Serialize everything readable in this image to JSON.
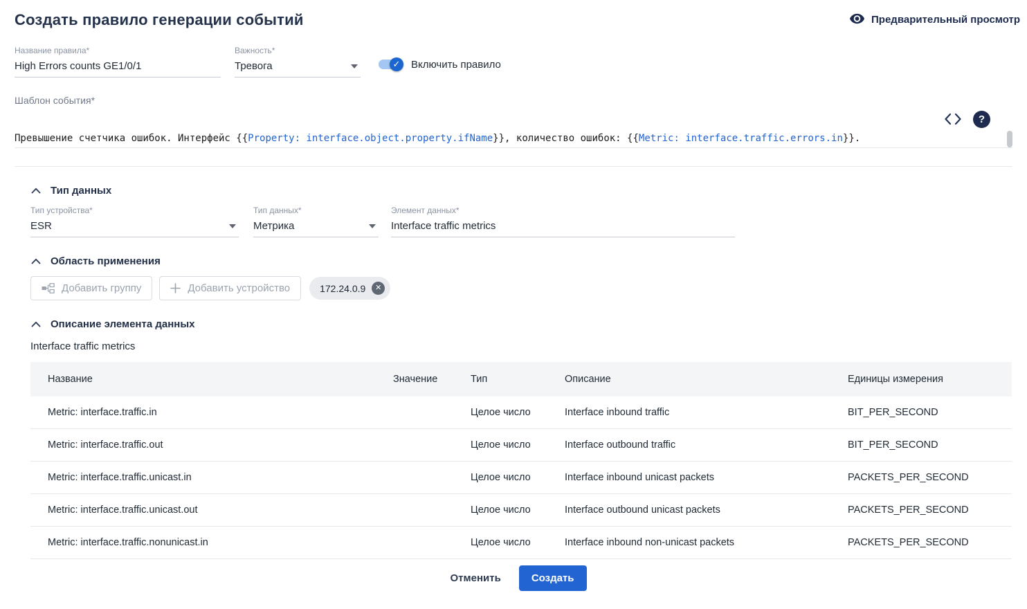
{
  "colors": {
    "accent_blue": "#2264d1",
    "title_navy": "#24324b",
    "token_blue": "#2264d1",
    "table_header_bg": "#f4f5f7"
  },
  "header": {
    "title": "Создать правило генерации событий",
    "preview_label": "Предварительный просмотр"
  },
  "form": {
    "rule_name": {
      "label": "Название правила*",
      "value": "High Errors counts GE1/0/1"
    },
    "severity": {
      "label": "Важность*",
      "value": "Тревога"
    },
    "enable_label": "Включить правило",
    "template_label": "Шаблон события*",
    "template": {
      "p1": "Превышение счетчика ошибок. Интерфейс {{",
      "t1": "Property: interface.object.property.ifName",
      "p2": "}}, количество ошибок: {{",
      "t2": "Metric: interface.traffic.errors.in",
      "p3": "}}."
    }
  },
  "data_type_section": {
    "title": "Тип данных",
    "device_type": {
      "label": "Тип устройства*",
      "value": "ESR"
    },
    "data_kind": {
      "label": "Тип данных*",
      "value": "Метрика"
    },
    "data_element": {
      "label": "Элемент данных*",
      "value": "Interface traffic metrics"
    }
  },
  "scope_section": {
    "title": "Область применения",
    "add_group_label": "Добавить группу",
    "add_device_label": "Добавить устройство",
    "device_chip": "172.24.0.9"
  },
  "description_section": {
    "title": "Описание элемента данных",
    "subtitle": "Interface traffic metrics",
    "headers": [
      "Название",
      "Значение",
      "Тип",
      "Описание",
      "Единицы измерения"
    ],
    "rows": [
      [
        "Metric: interface.traffic.in",
        "",
        "Целое число",
        "Interface inbound traffic",
        "BIT_PER_SECOND"
      ],
      [
        "Metric: interface.traffic.out",
        "",
        "Целое число",
        "Interface outbound traffic",
        "BIT_PER_SECOND"
      ],
      [
        "Metric: interface.traffic.unicast.in",
        "",
        "Целое число",
        "Interface inbound unicast packets",
        "PACKETS_PER_SECOND"
      ],
      [
        "Metric: interface.traffic.unicast.out",
        "",
        "Целое число",
        "Interface outbound unicast packets",
        "PACKETS_PER_SECOND"
      ],
      [
        "Metric: interface.traffic.nonunicast.in",
        "",
        "Целое число",
        "Interface inbound non-unicast packets",
        "PACKETS_PER_SECOND"
      ]
    ]
  },
  "footer": {
    "cancel_label": "Отменить",
    "create_label": "Создать"
  }
}
